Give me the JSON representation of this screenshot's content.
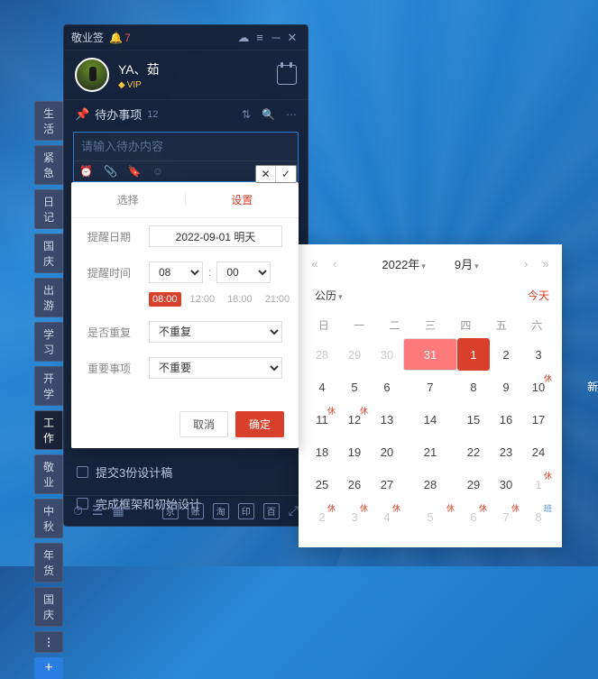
{
  "app": {
    "name": "敬业签",
    "notif_count": "7"
  },
  "titlebar_icons": [
    "cloud-icon",
    "menu-icon",
    "minimize-icon",
    "close-icon"
  ],
  "user": {
    "name": "YA、茹",
    "vip": "VIP"
  },
  "side_tabs": [
    "生活",
    "紧急",
    "日记",
    "国庆",
    "出游",
    "学习",
    "开学",
    "工作",
    "敬业",
    "中秋",
    "年货",
    "国庆"
  ],
  "section": {
    "title": "待办事项",
    "count": "12"
  },
  "input": {
    "placeholder": "请输入待办内容"
  },
  "todos": [
    "提交3份设计稿",
    "完成框架和初始设计"
  ],
  "bottom_chips": [
    "京",
    "账",
    "淘",
    "印",
    "百"
  ],
  "mini_actions": {
    "cancel": "✕",
    "confirm": "✓"
  },
  "settings": {
    "tab_select": "选择",
    "tab_set": "设置",
    "label_date": "提醒日期",
    "date_value": "2022-09-01 明天",
    "label_time": "提醒时间",
    "hour": "08",
    "minute": "00",
    "presets": [
      "08:00",
      "12:00",
      "18:00",
      "21:00"
    ],
    "preset_active": 0,
    "label_repeat": "是否重复",
    "repeat_value": "不重复",
    "label_important": "重要事项",
    "important_value": "不重要",
    "btn_cancel": "取消",
    "btn_ok": "确定"
  },
  "calendar": {
    "year": "2022年",
    "month": "9月",
    "system": "公历",
    "today_link": "今天",
    "weekdays": [
      "日",
      "一",
      "二",
      "三",
      "四",
      "五",
      "六"
    ],
    "rest_mark": "休",
    "work_mark": "班",
    "grid": [
      [
        {
          "n": "28",
          "dim": true
        },
        {
          "n": "29",
          "dim": true
        },
        {
          "n": "30",
          "dim": true
        },
        {
          "n": "31",
          "sel": true
        },
        {
          "n": "1",
          "today": true
        },
        {
          "n": "2"
        },
        {
          "n": "3"
        }
      ],
      [
        {
          "n": "4"
        },
        {
          "n": "5"
        },
        {
          "n": "6"
        },
        {
          "n": "7"
        },
        {
          "n": "8"
        },
        {
          "n": "9"
        },
        {
          "n": "10",
          "rest": true
        }
      ],
      [
        {
          "n": "11",
          "rest": true
        },
        {
          "n": "12",
          "rest": true
        },
        {
          "n": "13"
        },
        {
          "n": "14"
        },
        {
          "n": "15"
        },
        {
          "n": "16"
        },
        {
          "n": "17"
        }
      ],
      [
        {
          "n": "18"
        },
        {
          "n": "19"
        },
        {
          "n": "20"
        },
        {
          "n": "21"
        },
        {
          "n": "22"
        },
        {
          "n": "23"
        },
        {
          "n": "24"
        }
      ],
      [
        {
          "n": "25"
        },
        {
          "n": "26"
        },
        {
          "n": "27"
        },
        {
          "n": "28"
        },
        {
          "n": "29"
        },
        {
          "n": "30"
        },
        {
          "n": "1",
          "dim": true,
          "rest": true
        }
      ],
      [
        {
          "n": "2",
          "dim": true,
          "rest": true
        },
        {
          "n": "3",
          "dim": true,
          "rest": true
        },
        {
          "n": "4",
          "dim": true,
          "rest": true
        },
        {
          "n": "5",
          "dim": true,
          "rest": true
        },
        {
          "n": "6",
          "dim": true,
          "rest": true
        },
        {
          "n": "7",
          "dim": true,
          "rest": true
        },
        {
          "n": "8",
          "dim": true,
          "work": true
        }
      ]
    ]
  },
  "truncated_text": "新"
}
